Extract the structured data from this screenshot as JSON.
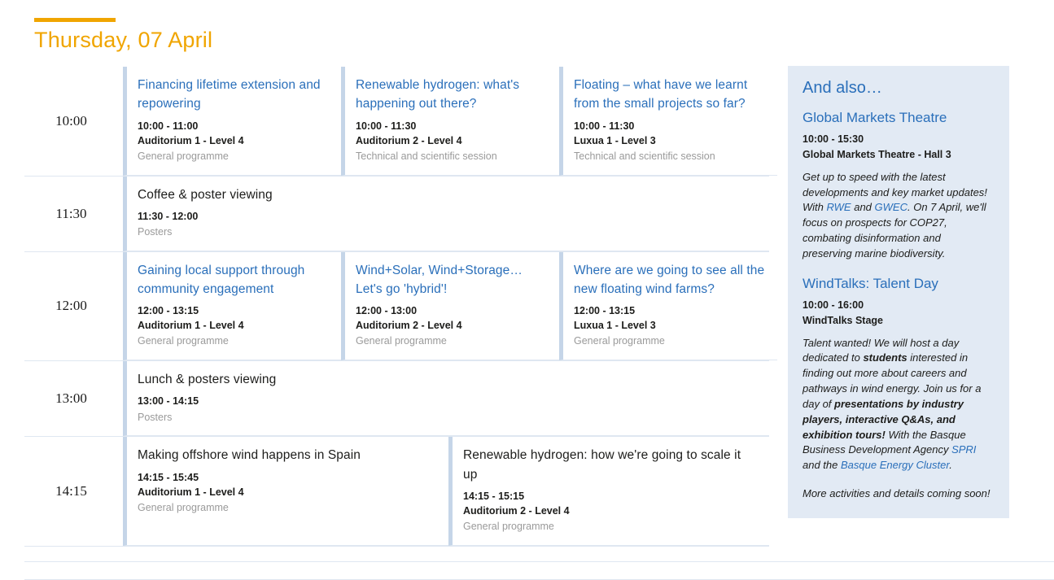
{
  "day": {
    "title": "Thursday, 07 April",
    "accent_color": "#f0a500"
  },
  "colors": {
    "link": "#2a6fba",
    "card_accent": "#c5d5e8",
    "aside_bg": "#e2eaf4",
    "muted": "#9a9a9a"
  },
  "schedule": {
    "rows": [
      {
        "time": "10:00",
        "sessions": [
          {
            "title": "Financing lifetime extension and repowering",
            "time": "10:00 - 11:00",
            "room": "Auditorium 1 - Level 4",
            "track": "General programme",
            "title_style": "link"
          },
          {
            "title": "Renewable hydrogen: what's happening out there?",
            "time": "10:00 - 11:30",
            "room": "Auditorium 2 - Level 4",
            "track": "Technical and scientific session",
            "title_style": "link"
          },
          {
            "title": "Floating – what have we learnt from the small projects so far?",
            "time": "10:00 - 11:30",
            "room": "Luxua 1 - Level 3",
            "track": "Technical and scientific session",
            "title_style": "link"
          }
        ]
      },
      {
        "time": "11:30",
        "sessions": [
          {
            "title": "Coffee & poster viewing",
            "time": "11:30 - 12:00",
            "room": "",
            "track": "Posters",
            "title_style": "dark"
          }
        ]
      },
      {
        "time": "12:00",
        "sessions": [
          {
            "title": "Gaining local support through community engagement",
            "time": "12:00 - 13:15",
            "room": "Auditorium 1 - Level 4",
            "track": "General programme",
            "title_style": "link"
          },
          {
            "title": "Wind+Solar, Wind+Storage… Let's go 'hybrid'!",
            "time": "12:00 - 13:00",
            "room": "Auditorium 2 - Level 4",
            "track": "General programme",
            "title_style": "link"
          },
          {
            "title": "Where are we going to see all the new floating wind farms?",
            "time": "12:00 - 13:15",
            "room": "Luxua 1 - Level 3",
            "track": "General programme",
            "title_style": "link"
          }
        ]
      },
      {
        "time": "13:00",
        "sessions": [
          {
            "title": "Lunch & posters viewing",
            "time": "13:00 - 14:15",
            "room": "",
            "track": "Posters",
            "title_style": "dark"
          }
        ]
      },
      {
        "time": "14:15",
        "sessions": [
          {
            "title": "Making offshore wind happens in Spain",
            "time": "14:15 - 15:45",
            "room": "Auditorium 1 - Level 4",
            "track": "General programme",
            "title_style": "dark"
          },
          {
            "title": "Renewable hydrogen: how we're going to scale it up",
            "time": "14:15 - 15:15",
            "room": "Auditorium 2 - Level 4",
            "track": "General programme",
            "title_style": "dark"
          }
        ]
      }
    ]
  },
  "aside": {
    "title": "And also…",
    "blocks": [
      {
        "heading": "Global Markets Theatre",
        "time": "10:00 - 15:30",
        "venue": "Global Markets Theatre - Hall 3",
        "description_parts": [
          {
            "text": "Get up to speed with the latest developments and key market updates! With ",
            "style": "plain"
          },
          {
            "text": "RWE",
            "style": "link"
          },
          {
            "text": " and ",
            "style": "plain"
          },
          {
            "text": "GWEC",
            "style": "link"
          },
          {
            "text": ". On 7 April, we'll focus on prospects for COP27, combating disinformation and preserving marine biodiversity.",
            "style": "plain"
          }
        ]
      },
      {
        "heading": "WindTalks: Talent Day",
        "time": "10:00 - 16:00",
        "venue": "WindTalks Stage",
        "description_parts": [
          {
            "text": "Talent wanted! We will host a day dedicated to ",
            "style": "plain"
          },
          {
            "text": "students",
            "style": "bold"
          },
          {
            "text": " interested in finding out more about careers and pathways in wind energy. Join us for a day of ",
            "style": "plain"
          },
          {
            "text": "presentations by industry players, interactive Q&As, and exhibition tours!",
            "style": "bold"
          },
          {
            "text": " With the Basque Business Development Agency ",
            "style": "plain"
          },
          {
            "text": "SPRI",
            "style": "link"
          },
          {
            "text": " and the ",
            "style": "plain"
          },
          {
            "text": "Basque Energy Cluster",
            "style": "link"
          },
          {
            "text": ".",
            "style": "plain"
          }
        ]
      }
    ],
    "note": "More activities and details coming soon!"
  }
}
